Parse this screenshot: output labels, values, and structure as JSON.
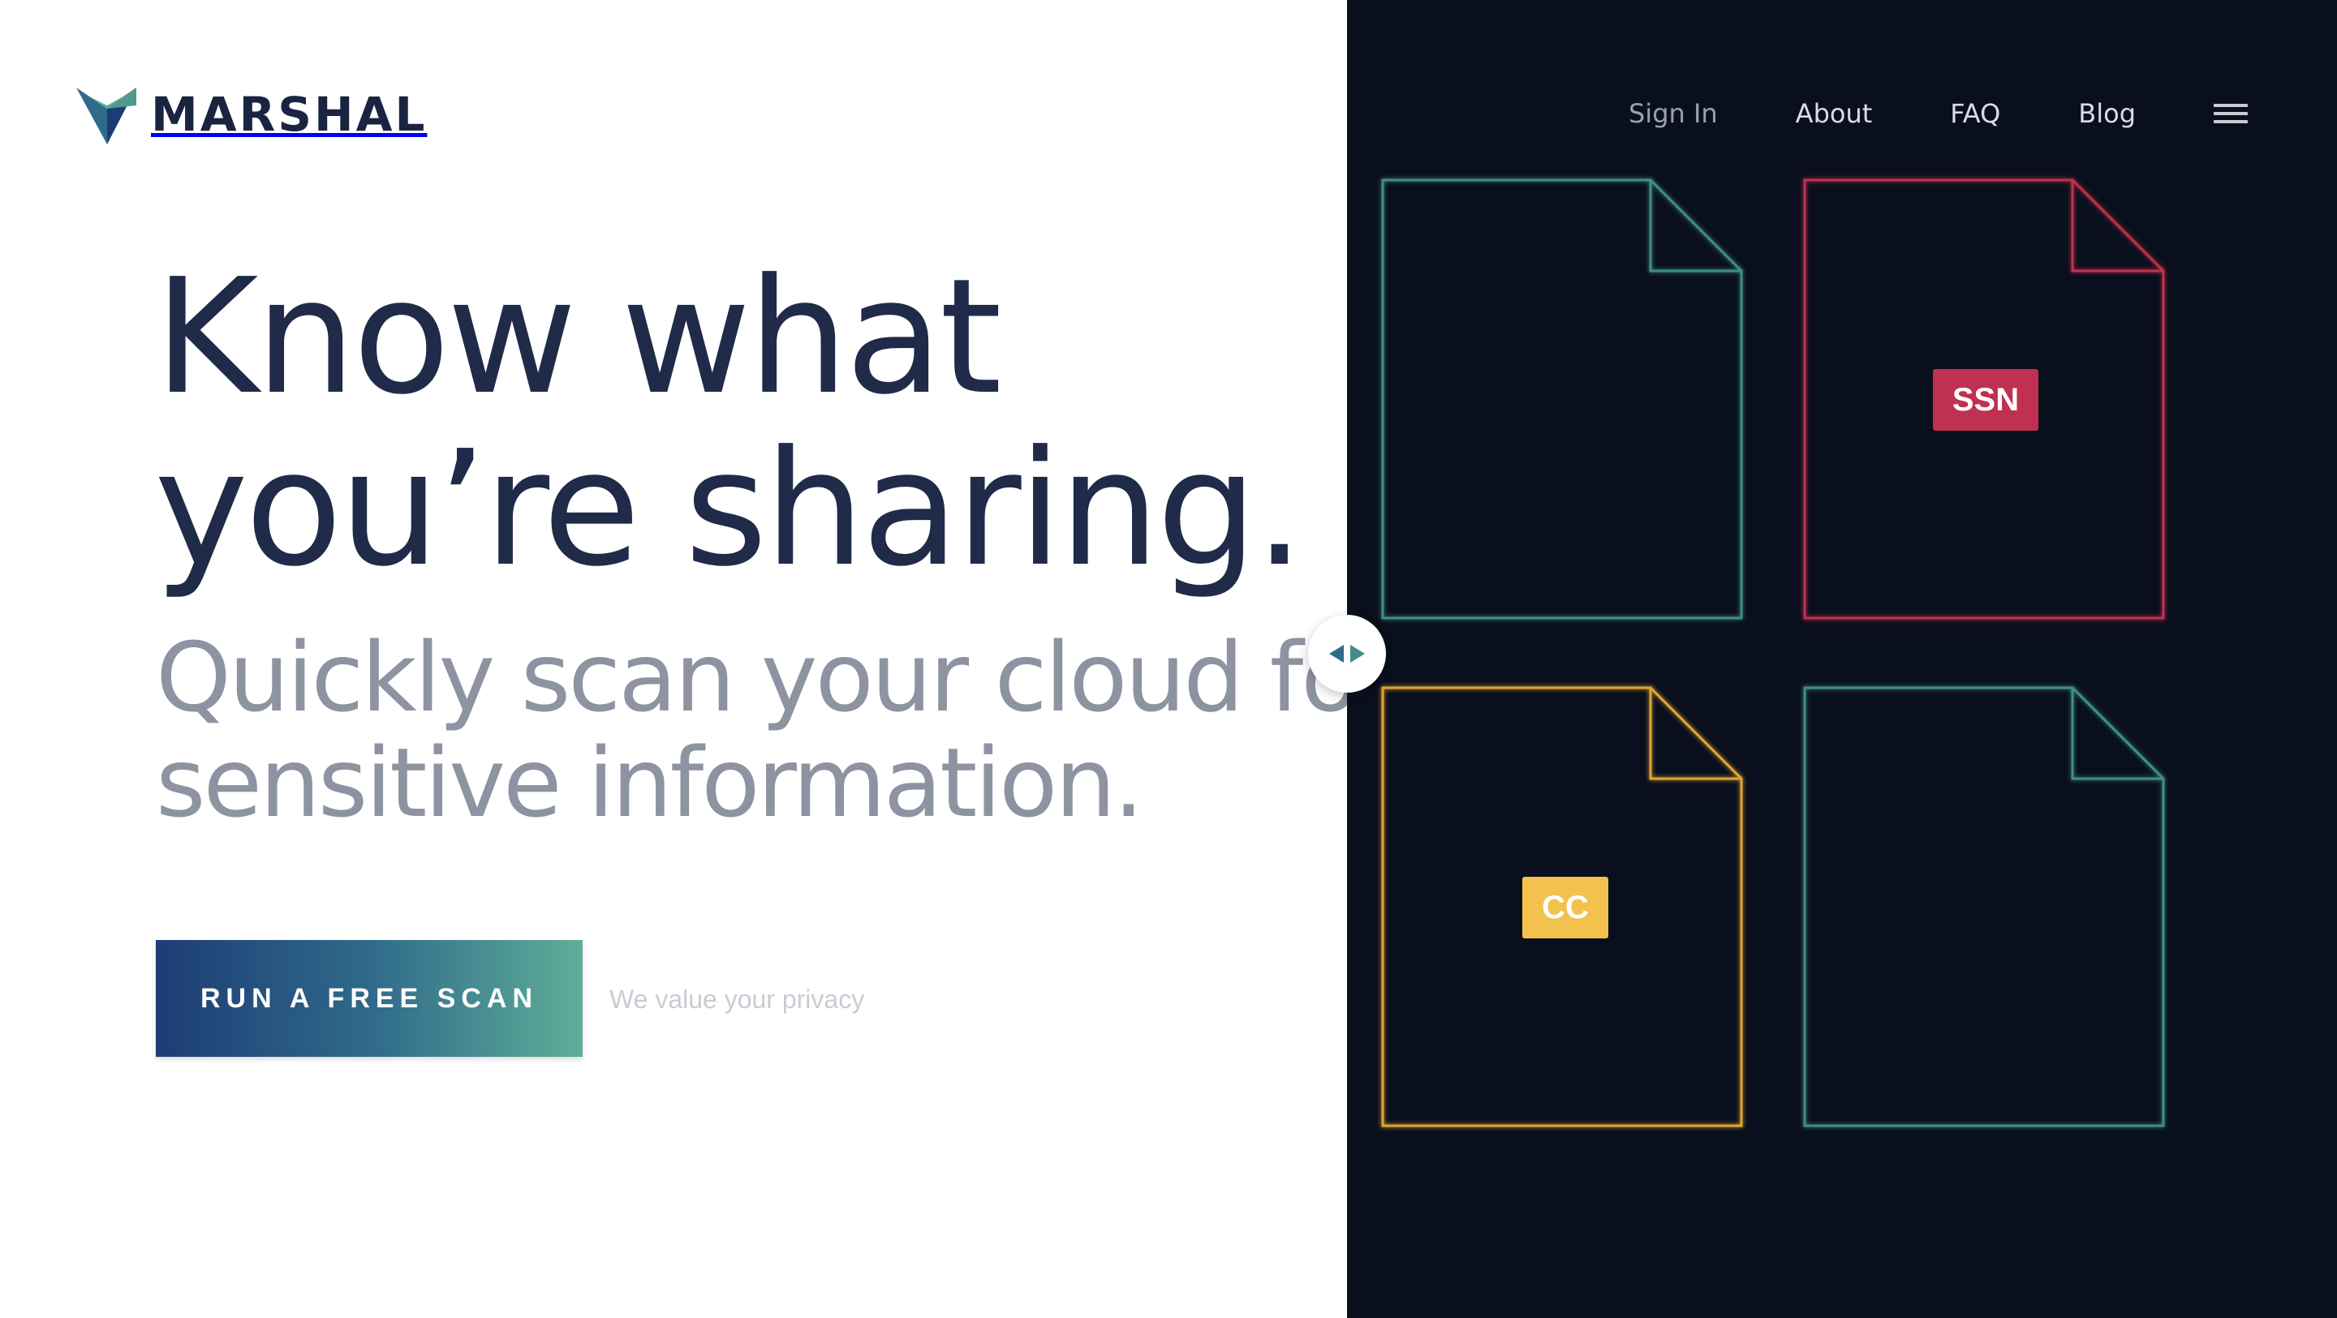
{
  "brand": {
    "name": "MARSHAL",
    "logo_colors": [
      "#2f6a8a",
      "#5fae98",
      "#1d3c74"
    ]
  },
  "hero": {
    "headline_line1": "Know what",
    "headline_line2": "you’re sharing.",
    "subhead_line1": "Quickly scan your cloud for",
    "subhead_line2": "sensitive information.",
    "cta_label": "RUN A FREE SCAN",
    "privacy_link": "We value your privacy"
  },
  "nav": {
    "sign_in": "Sign In",
    "about": "About",
    "faq": "FAQ",
    "blog": "Blog",
    "menu_icon": "hamburger-menu-icon"
  },
  "documents": [
    {
      "outline_color": "#3f8f86",
      "tag": ""
    },
    {
      "outline_color": "#c03050",
      "tag": "SSN",
      "tag_color": "#c03050"
    },
    {
      "outline_color": "#e0a632",
      "tag": "CC",
      "tag_color": "#f2c14e"
    },
    {
      "outline_color": "#3f8f86",
      "tag": ""
    }
  ],
  "divider_handle": {
    "icon": "left-right-arrows-icon",
    "arrow_color": "#2f6a8a"
  },
  "colors": {
    "dark_panel": "#0a0f1d",
    "headline": "#1f2b48",
    "subhead": "#8e93a1"
  }
}
